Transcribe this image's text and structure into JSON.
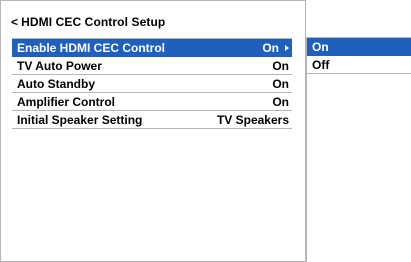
{
  "header": {
    "back_symbol": "<",
    "title": "HDMI CEC Control Setup"
  },
  "menu": {
    "items": [
      {
        "label": "Enable HDMI CEC Control",
        "value": "On",
        "selected": true
      },
      {
        "label": "TV Auto Power",
        "value": "On",
        "selected": false
      },
      {
        "label": "Auto Standby",
        "value": "On",
        "selected": false
      },
      {
        "label": "Amplifier Control",
        "value": "On",
        "selected": false
      },
      {
        "label": "Initial Speaker Setting",
        "value": "TV Speakers",
        "selected": false
      }
    ]
  },
  "options": {
    "items": [
      {
        "label": "On",
        "selected": true
      },
      {
        "label": "Off",
        "selected": false
      }
    ]
  },
  "colors": {
    "highlight": "#1f5fbd",
    "highlight_text": "#ffffff",
    "divider": "#b5b5b5"
  },
  "icons": {
    "submenu": "triangle-right-icon",
    "back": "back-arrow-icon"
  }
}
